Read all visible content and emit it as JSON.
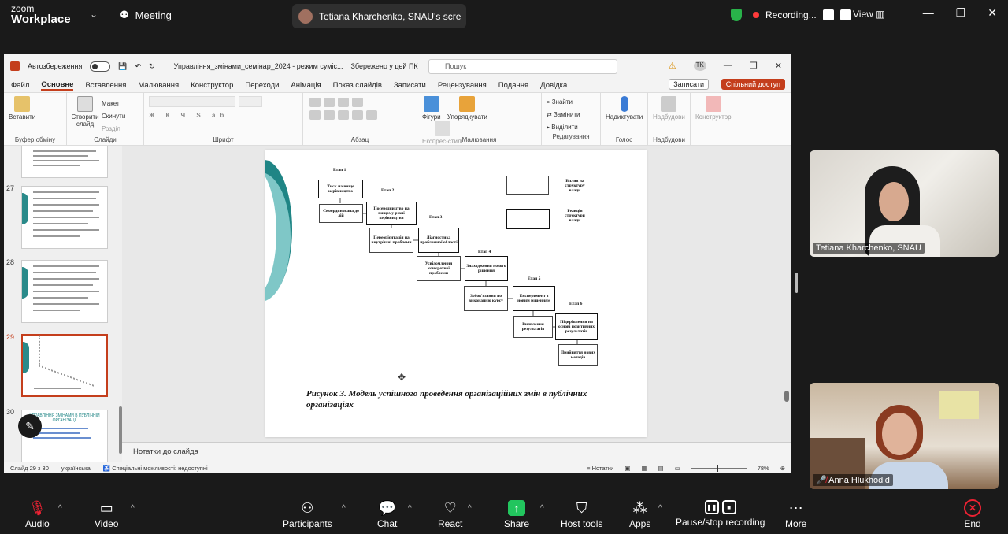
{
  "zoom": {
    "logo_line1": "zoom",
    "logo_line2": "Workplace",
    "meeting_label": "Meeting",
    "share_label": "Tetiana Kharchenko, SNAU's scre",
    "recording_label": "Recording...",
    "view_label": "View"
  },
  "ppt": {
    "autosave_label": "Автозбереження",
    "file_title": "Управління_змінами_семінар_2024 - режим суміс...",
    "saved_label": "Збережено у цей ПК",
    "search_placeholder": "Пошук",
    "user_initials": "TK",
    "tabs": [
      "Файл",
      "Основне",
      "Вставлення",
      "Малювання",
      "Конструктор",
      "Переходи",
      "Анімація",
      "Показ слайдів",
      "Записати",
      "Рецензування",
      "Подання",
      "Довідка"
    ],
    "record_btn": "Записати",
    "share_btn": "Спільний доступ",
    "ribbon": {
      "paste": "Вставити",
      "clipboard": "Буфер обміну",
      "new_slide": "Створити слайд",
      "layout": "Макет",
      "reset": "Скинути",
      "section": "Розділ",
      "slides": "Слайди",
      "font": "Шрифт",
      "paragraph": "Абзац",
      "shapes": "Фігури",
      "arrange": "Упорядкувати",
      "express": "Експрес-стилі",
      "drawing": "Малювання",
      "find": "Знайти",
      "replace": "Замінити",
      "select": "Виділити",
      "editing": "Редагування",
      "dictate": "Надиктувати",
      "voice": "Голос",
      "addins": "Надбудови",
      "addins_group": "Надбудови",
      "designer": "Конструктор"
    },
    "thumbs": {
      "n27": "27",
      "n28": "28",
      "n29": "29",
      "n30": "30",
      "t30_title": "УПРАВЛІННЯ ЗМІНАМИ В ПУБЛІЧНІЙ ОРГАНІЗАЦІЇ"
    },
    "slide": {
      "stages": [
        "Етап 1",
        "Етап 2",
        "Етап 3",
        "Етап 4",
        "Етап 5",
        "Етап 6"
      ],
      "boxes": {
        "b1": "Тиск на вище керівництво",
        "b2": "Скоординована до дій",
        "b3": "Посередництво на вищому рівні керівництва",
        "b4": "Переорієнтація на внутрішні проблеми",
        "b5": "Діагностика проблемної області",
        "b6": "Усвідомлення конкретної проблеми",
        "b7": "Знаходження нового рішення",
        "b8": "Зобов'язання по виконанню курсу",
        "b9": "Експеримент з новим рішенням",
        "b10": "Виявлення результатів",
        "b11": "Підкріплення на основі позитивних результатів",
        "b12": "Прийняття нових методів"
      },
      "legend1": "Вплив на структуру влади",
      "legend2": "Реакція структури влади",
      "caption": "Рисунок 3. Модель успішного проведення організаційних змін в публічних організаціях"
    },
    "notes_placeholder": "Нотатки до слайда",
    "status": {
      "slide": "Слайд 29 з 30",
      "lang": "українська",
      "access": "Спеціальні можливості: недоступні",
      "notes": "Нотатки",
      "zoom": "78%"
    }
  },
  "participants": {
    "p1": "Tetiana Kharchenko, SNAU",
    "p2": "Anna Hlukhodid"
  },
  "toolbar": {
    "audio": "Audio",
    "video": "Video",
    "participants": "Participants",
    "chat": "Chat",
    "react": "React",
    "share": "Share",
    "host_tools": "Host tools",
    "apps": "Apps",
    "pause_rec": "Pause/stop recording",
    "more": "More",
    "end": "End"
  }
}
